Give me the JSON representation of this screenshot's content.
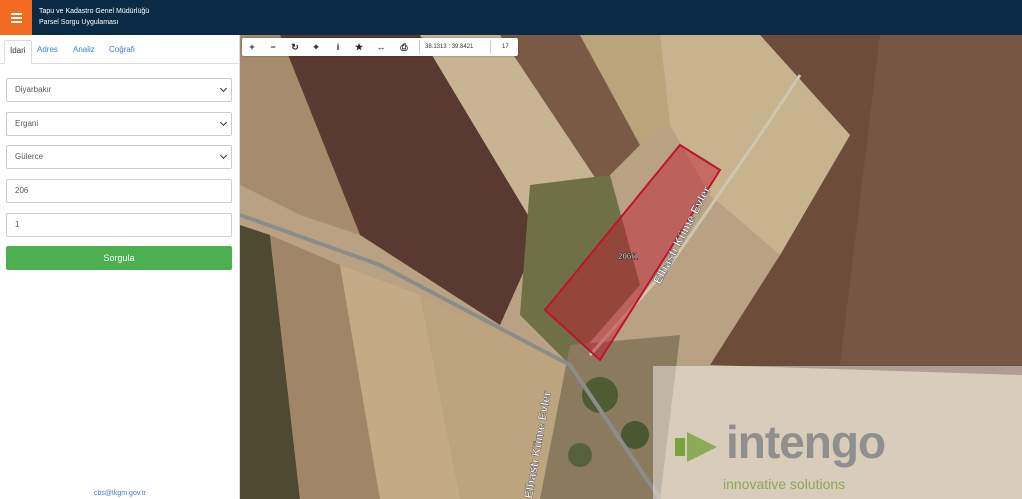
{
  "header": {
    "title_line1": "Tapu ve Kadastro Genel Müdürlüğü",
    "title_line2": "Parsel Sorgu Uygulaması"
  },
  "tabs": [
    {
      "label": "İdari",
      "active": true
    },
    {
      "label": "Adres",
      "active": false
    },
    {
      "label": "Analiz",
      "active": false
    },
    {
      "label": "Coğrafi",
      "active": false
    }
  ],
  "form": {
    "province": "Diyarbakır",
    "district": "Ergani",
    "neighborhood": "Gülerce",
    "block": "206",
    "parcel": "1",
    "query_label": "Sorgula"
  },
  "footer": {
    "email": "cbs@tkgm.gov.tr"
  },
  "map": {
    "coordinates": "38.1313 : 39.8421",
    "zoom": "17",
    "parcel_label": "206/1",
    "road_label_1": "Elbastı Küme Evler",
    "road_label_2": "Elbastı Küme Evler",
    "parcel_color": "#c0142c"
  },
  "watermark": {
    "brand": "intengo",
    "tagline": "innovative solutions"
  },
  "colors": {
    "header_bg": "#0b2a45",
    "menu_accent": "#f26b21",
    "button_green": "#4caf50",
    "link_blue": "#3d7ecb"
  }
}
